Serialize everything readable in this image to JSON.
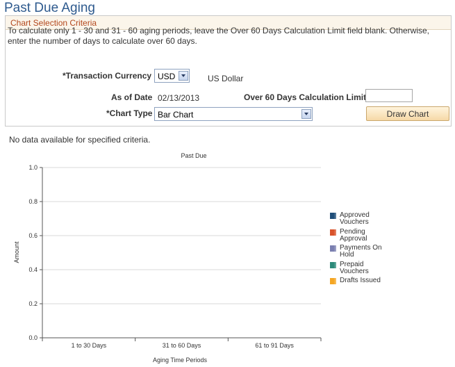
{
  "page": {
    "title": "Past Due Aging"
  },
  "criteria": {
    "header": "Chart Selection Criteria",
    "instructions": "To calculate only 1 - 30 and 31 - 60 aging periods, leave the Over 60 Days Calculation Limit field blank. Otherwise, enter the number of days to calculate over 60 days.",
    "currency_label": "*Transaction Currency",
    "currency_value": "USD",
    "currency_desc": "US Dollar",
    "asof_label": "As of Date",
    "asof_value": "02/13/2013",
    "over60_label": "Over 60 Days Calculation Limit",
    "over60_value": "",
    "charttype_label": "*Chart Type",
    "charttype_value": "Bar Chart",
    "draw_button": "Draw Chart"
  },
  "message": "No data available for specified criteria.",
  "chart_data": {
    "type": "bar",
    "title": "Past Due",
    "xlabel": "Aging Time Periods",
    "ylabel": "Amount",
    "categories": [
      "1 to 30 Days",
      "31 to 60 Days",
      "61 to 91 Days"
    ],
    "yticks": [
      "0.0",
      "0.2",
      "0.4",
      "0.6",
      "0.8",
      "1.0"
    ],
    "ylim": [
      0,
      1
    ],
    "grid": true,
    "legend_position": "right",
    "series": [
      {
        "name": "Approved Vouchers",
        "color": "#1f4e79",
        "values": []
      },
      {
        "name": "Pending Approval",
        "color": "#d9532b",
        "values": []
      },
      {
        "name": "Payments On Hold",
        "color": "#7a7fb0",
        "values": []
      },
      {
        "name": "Prepaid Vouchers",
        "color": "#2c8a7a",
        "values": []
      },
      {
        "name": "Drafts Issued",
        "color": "#f5a623",
        "values": []
      }
    ]
  }
}
